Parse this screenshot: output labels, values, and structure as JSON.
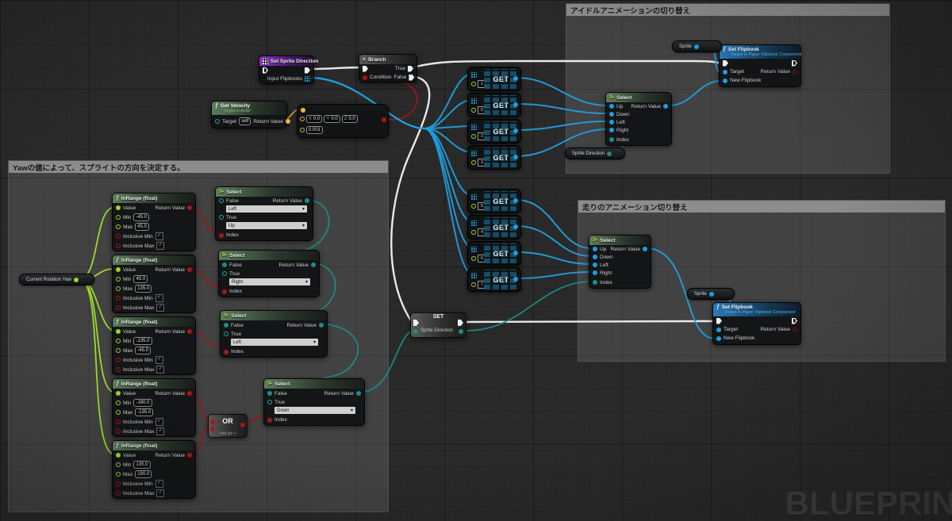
{
  "watermark": "BLUEPRINT",
  "comments": {
    "idle": "アイドルアニメーションの切り替え",
    "run": "走りのアニメーション切り替え",
    "yaw": "Yawの値によって、スプライトの方向を決定する。"
  },
  "icons": {
    "function": "ƒ",
    "select_icon": "3+",
    "branch_icon": "<",
    "check": "✓",
    "arrow": "▾"
  },
  "labels": {
    "return_value": "Return Value",
    "index": "Index",
    "true": "True",
    "false": "False",
    "up": "Up",
    "down": "Down",
    "left": "Left",
    "right": "Right",
    "target": "Target",
    "new_flipbook": "New Flipbook",
    "input_flipbooks": "Input Flipbooks",
    "condition": "Condition",
    "value": "Value",
    "min": "Min",
    "max": "Max",
    "inclusive_min": "Inclusive Min",
    "inclusive_max": "Inclusive Max",
    "get": "GET",
    "set": "SET",
    "or": "OR",
    "add_pin": "Add pin +",
    "select": "Select",
    "self": "self",
    "sprite_direction": "Sprite Direction"
  },
  "nodes": {
    "set_sprite_direction_title": "Set Sprite Direction",
    "branch_title": "Branch",
    "get_velocity_title": "Get Velocity",
    "get_velocity_subtitle": "Target is Actor",
    "set_flipbook_title": "Set Flipbook",
    "set_flipbook_subtitle": "Target is Paper Flipbook Component",
    "inrange_title": "InRange (float)",
    "compare": {
      "x_label": "X",
      "x": "0.0",
      "y_label": "Y",
      "y": "0.0",
      "z_label": "Z",
      "z": "0.0",
      "tolerance": "0.001"
    },
    "get_indices": [
      "1",
      "0",
      "2",
      "3",
      "5",
      "4",
      "6",
      "7"
    ],
    "inrange_values": [
      {
        "min": "-45.0",
        "max": "45.0"
      },
      {
        "min": "45.0",
        "max": "135.0"
      },
      {
        "min": "-135.0",
        "max": "-45.0"
      },
      {
        "min": "-180.0",
        "max": "-135.0"
      },
      {
        "min": "135.0",
        "max": "180.0"
      }
    ],
    "select_options": {
      "s1_false": "Left",
      "s1_true": "Up",
      "s2_true": "Right",
      "s3_true": "Left",
      "s4_true": "Down"
    }
  },
  "pills": {
    "sprite": "Sprite",
    "sprite_direction": "Sprite Direction",
    "current_rotation_yaw": "Current Rotation Yaw"
  }
}
